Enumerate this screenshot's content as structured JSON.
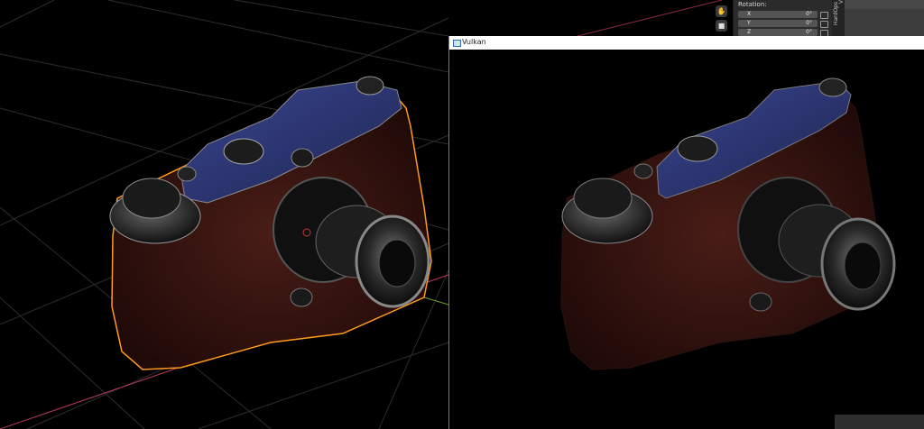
{
  "editor": {
    "panel": {
      "heading": "Rotation:",
      "rows": [
        {
          "axis": "X",
          "value": "0°"
        },
        {
          "axis": "Y",
          "value": "0°"
        },
        {
          "axis": "Z",
          "value": "0°"
        }
      ]
    },
    "tabs": [
      "HardOps",
      "V"
    ]
  },
  "render_window": {
    "title": "Vulkan"
  },
  "colors": {
    "selection_outline": "#ff9a1a",
    "x_axis": "#b8385a",
    "y_axis": "#6a9a2a",
    "body_leather": "#3a1612",
    "top_plate": "#2e3770"
  }
}
